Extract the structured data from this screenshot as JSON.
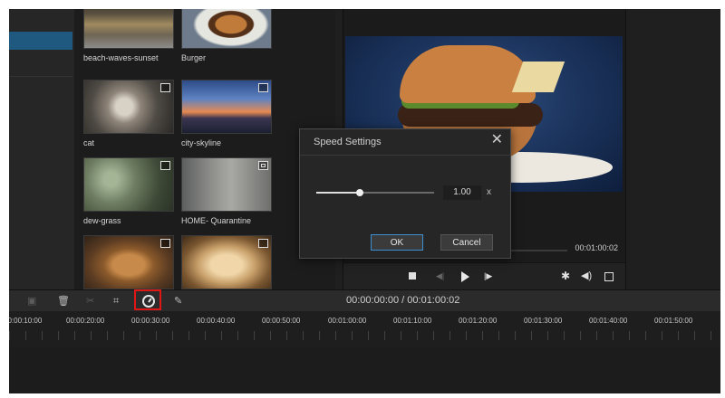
{
  "media": {
    "items": [
      {
        "label": "beach-waves-sunset",
        "thumb": "beach",
        "type": "image-icon"
      },
      {
        "label": "Burger",
        "thumb": "burger",
        "type": "video-icon"
      },
      {
        "label": "cat",
        "thumb": "cat",
        "type": "image-icon"
      },
      {
        "label": "city-skyline",
        "thumb": "city",
        "type": "image-icon"
      },
      {
        "label": "dew-grass",
        "thumb": "dew",
        "type": "image-icon"
      },
      {
        "label": "HOME- Quarantine",
        "thumb": "home",
        "type": "video-icon"
      },
      {
        "label": "",
        "thumb": "bread",
        "type": "image-icon"
      },
      {
        "label": "",
        "thumb": "pasta",
        "type": "image-icon"
      }
    ]
  },
  "preview": {
    "duration": "00:01:00:02",
    "progress": 0,
    "controls": [
      "stop-icon",
      "prev-frame-icon",
      "play-icon",
      "next-frame-icon",
      "settings-icon",
      "volume-icon",
      "fullscreen-icon"
    ]
  },
  "dialog": {
    "title": "Speed Settings",
    "close": "✕",
    "speed_value": "1.00",
    "speed_unit": "x",
    "slider_fraction": 0.37,
    "ok_label": "OK",
    "cancel_label": "Cancel"
  },
  "toolbar": {
    "icons": [
      "save-icon",
      "delete-icon",
      "split-icon",
      "crop-icon",
      "speed-icon",
      "edit-icon"
    ],
    "timecode": "00:00:00:00 / 00:01:00:02"
  },
  "timeline": {
    "labels": [
      "00:00:10:00",
      "00:00:20:00",
      "00:00:30:00",
      "00:00:40:00",
      "00:00:50:00",
      "00:01:00:00",
      "00:01:10:00",
      "00:01:20:00",
      "00:01:30:00",
      "00:01:40:00",
      "00:01:50:00"
    ]
  },
  "colors": {
    "accent": "#3d8fd1",
    "highlight": "#e01515",
    "selection": "#20597f"
  }
}
